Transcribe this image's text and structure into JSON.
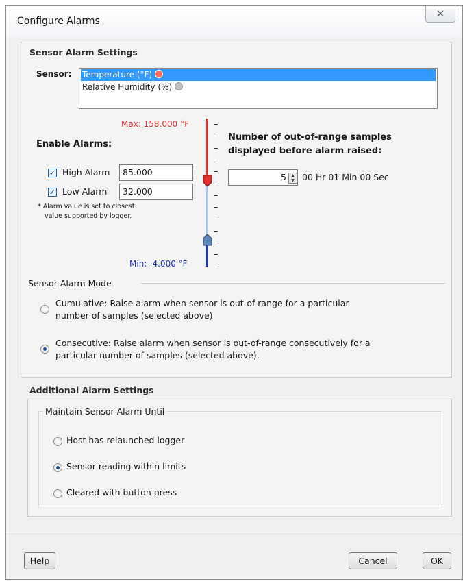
{
  "window": {
    "title": "Configure Alarms",
    "close_glyph": "✕"
  },
  "sensor_settings": {
    "heading": "Sensor Alarm Settings",
    "sensor_label": "Sensor:",
    "sensors": [
      "Temperature (°F)",
      "Relative Humidity (%)"
    ],
    "selected_sensor": "Temperature (°F)"
  },
  "scale": {
    "max_label": "Max: 158.000 °F",
    "min_label": "Min: -4.000 °F",
    "max": 158.0,
    "min": -4.0,
    "high_marker": 85.0,
    "low_marker": 32.0,
    "high_color": "#e03030",
    "low_color": "#2233bb"
  },
  "enable_alarms": {
    "heading": "Enable Alarms:",
    "high": {
      "label": "High Alarm",
      "checked": true,
      "value": "85.000"
    },
    "low": {
      "label": "Low Alarm",
      "checked": true,
      "value": "32.000"
    },
    "note_line1": "* Alarm value is set to closest",
    "note_line2": "value supported by logger."
  },
  "samples": {
    "heading_line1": "Number of out-of-range samples",
    "heading_line2": "displayed before alarm raised:",
    "value": "5",
    "duration": "00 Hr 01 Min 00 Sec"
  },
  "mode": {
    "heading": "Sensor Alarm Mode",
    "cumulative_line1": "Cumulative: Raise alarm when sensor is out-of-range for a particular",
    "cumulative_line2": "number of samples (selected above)",
    "consecutive_line1": "Consecutive: Raise alarm when sensor is out-of-range consecutively for a",
    "consecutive_line2": "particular number of samples (selected above).",
    "selected": "consecutive"
  },
  "additional": {
    "heading": "Additional Alarm Settings",
    "group_label": "Maintain Sensor Alarm Until",
    "options": [
      "Host has relaunched logger",
      "Sensor reading within limits",
      "Cleared with button press"
    ],
    "selected": "Sensor reading within limits"
  },
  "buttons": {
    "help": "Help",
    "cancel": "Cancel",
    "ok": "OK"
  }
}
